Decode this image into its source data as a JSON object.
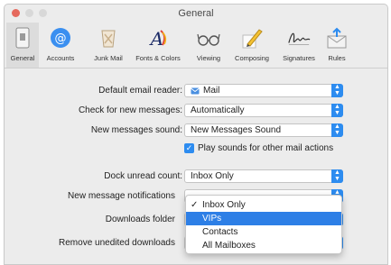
{
  "window": {
    "title": "General",
    "traffic_lights": [
      "#e5695d",
      "#d8d8d8",
      "#d8d8d8"
    ]
  },
  "toolbar": {
    "tabs": [
      {
        "label": "General",
        "icon": "switch-icon"
      },
      {
        "label": "Accounts",
        "icon": "at-sign-icon"
      },
      {
        "label": "Junk Mail",
        "icon": "junk-bin-icon"
      },
      {
        "label": "Fonts & Colors",
        "icon": "fonts-icon"
      },
      {
        "label": "Viewing",
        "icon": "glasses-icon"
      },
      {
        "label": "Composing",
        "icon": "pencil-paper-icon"
      },
      {
        "label": "Signatures",
        "icon": "signature-icon"
      },
      {
        "label": "Rules",
        "icon": "rules-envelope-icon"
      }
    ]
  },
  "settings": {
    "default_reader": {
      "label": "Default email reader:",
      "value": "Mail"
    },
    "check_messages": {
      "label": "Check for new messages:",
      "value": "Automatically"
    },
    "messages_sound": {
      "label": "New messages sound:",
      "value": "New Messages Sound"
    },
    "play_sounds": {
      "label": "Play sounds for other mail actions",
      "checked": true
    },
    "dock_unread": {
      "label": "Dock unread count:",
      "value": "Inbox Only"
    },
    "notifications": {
      "label": "New message notifications"
    },
    "downloads": {
      "label": "Downloads folder"
    },
    "remove_downloads": {
      "label": "Remove unedited downloads"
    }
  },
  "notification_menu": {
    "items": [
      "Inbox Only",
      "VIPs",
      "Contacts",
      "All Mailboxes"
    ],
    "checked": "Inbox Only",
    "highlighted": "VIPs"
  },
  "colors": {
    "accent": "#2d8cf0",
    "highlight": "#2d7fe6"
  }
}
